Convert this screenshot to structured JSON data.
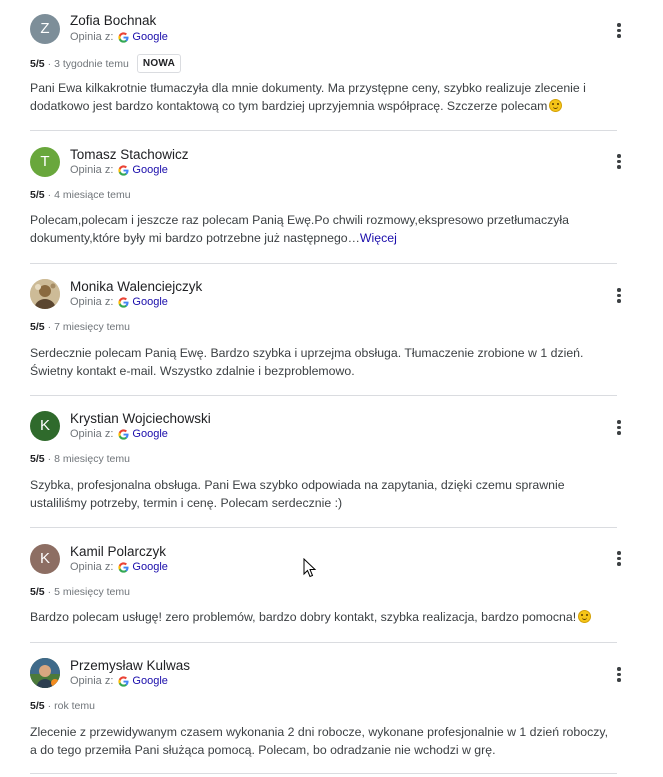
{
  "labels": {
    "source_prefix": "Opinia z:",
    "source_name": "Google"
  },
  "colors": {
    "link": "#1a0dab",
    "muted": "#70757a",
    "divider": "#dadce0"
  },
  "reviews": [
    {
      "name": "Zofia Bochnak",
      "initial": "Z",
      "avatar_color": "#7d8e99",
      "score": "5/5",
      "time": "3 tygodnie temu",
      "badge": "NOWA",
      "text": "Pani Ewa kilkakrotnie tłumaczyła dla mnie dokumenty. Ma przystępne ceny, szybko realizuje zlecenie i dodatkowo jest bardzo kontaktową co tym bardziej uprzyjemnia współpracę. Szczerze polecam",
      "emoji": "smiling-face-icon"
    },
    {
      "name": "Tomasz Stachowicz",
      "initial": "T",
      "avatar_color": "#69a73c",
      "score": "5/5",
      "time": "4 miesiące temu",
      "text": "Polecam,polecam i jeszcze raz polecam Panią Ewę.Po chwili rozmowy,ekspresowo przetłumaczyła dokumenty,które były mi bardzo potrzebne już następnego…",
      "more": "Więcej"
    },
    {
      "name": "Monika Walenciejczyk",
      "initial": "",
      "avatar_color": "#b89a6b",
      "score": "5/5",
      "time": "7 miesięcy temu",
      "text": "Serdecznie polecam Panią Ewę. Bardzo szybka i uprzejma obsługa. Tłumaczenie zrobione w 1 dzień. Świetny kontakt e-mail. Wszystko zdalnie i bezproblemowo."
    },
    {
      "name": "Krystian Wojciechowski",
      "initial": "K",
      "avatar_color": "#2f6a2c",
      "score": "5/5",
      "time": "8 miesięcy temu",
      "text": "Szybka, profesjonalna obsługa. Pani Ewa szybko odpowiada na zapytania, dzięki czemu sprawnie ustaliliśmy potrzeby, termin i cenę. Polecam serdecznie :)"
    },
    {
      "name": "Kamil Polarczyk",
      "initial": "K",
      "avatar_color": "#8d6e63",
      "score": "5/5",
      "time": "5 miesięcy temu",
      "text": "Bardzo polecam usługę! zero problemów, bardzo dobry kontakt, szybka realizacja, bardzo pomocna!",
      "emoji": "smiling-face-icon"
    },
    {
      "name": "Przemysław Kulwas",
      "initial": "",
      "avatar_color": "#4a6b3c",
      "score": "5/5",
      "time": "rok temu",
      "text": "Zlecenie z przewidywanym czasem wykonania 2 dni robocze, wykonane profesjonalnie w 1 dzień roboczy, a do tego przemiła Pani służąca pomocą. Polecam, bo odradzanie nie wchodzi w grę."
    }
  ]
}
